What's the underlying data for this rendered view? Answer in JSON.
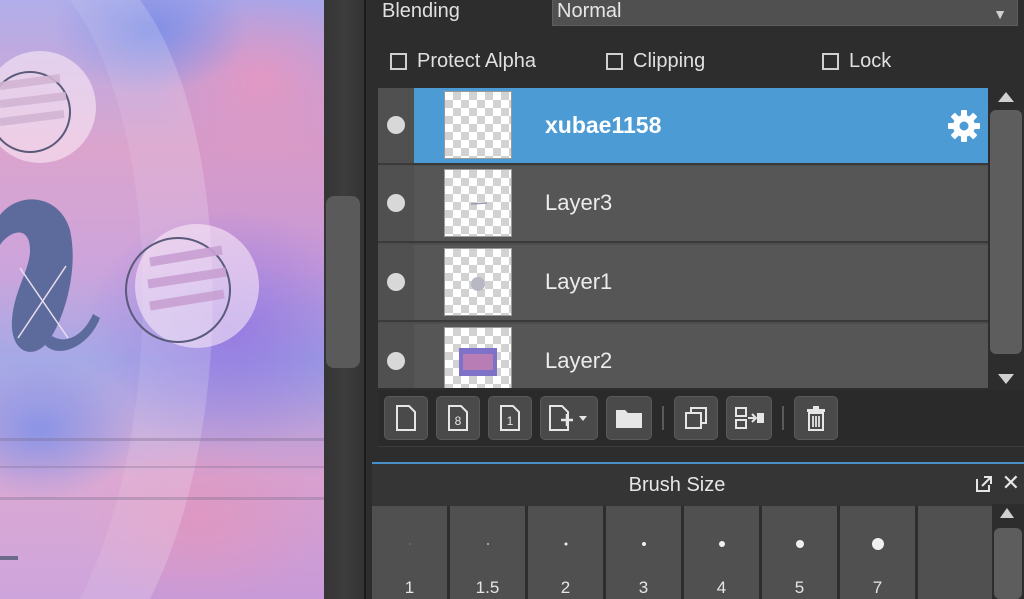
{
  "layer_panel": {
    "blending_label": "Blending",
    "blending_value": "Normal",
    "options": [
      {
        "label": "Protect Alpha",
        "checked": false
      },
      {
        "label": "Clipping",
        "checked": false
      },
      {
        "label": "Lock",
        "checked": false
      }
    ],
    "layers": [
      {
        "name": "xubae1158",
        "selected": true,
        "visible": true
      },
      {
        "name": "Layer3",
        "selected": false,
        "visible": true
      },
      {
        "name": "Layer1",
        "selected": false,
        "visible": true
      },
      {
        "name": "Layer2",
        "selected": false,
        "visible": true
      }
    ],
    "toolbar_icons": [
      "new-layer-icon",
      "new-8bit-layer-icon",
      "new-1bit-layer-icon",
      "add-layer-menu-icon",
      "new-folder-icon",
      "duplicate-layer-icon",
      "merge-down-icon",
      "delete-layer-icon"
    ]
  },
  "brush_size_panel": {
    "title": "Brush Size",
    "sizes": [
      "1",
      "1.5",
      "2",
      "3",
      "4",
      "5",
      "7"
    ]
  },
  "colors": {
    "selection": "#4d9bd5",
    "panel_bg": "#2d2d2d",
    "row_bg": "#565656"
  }
}
